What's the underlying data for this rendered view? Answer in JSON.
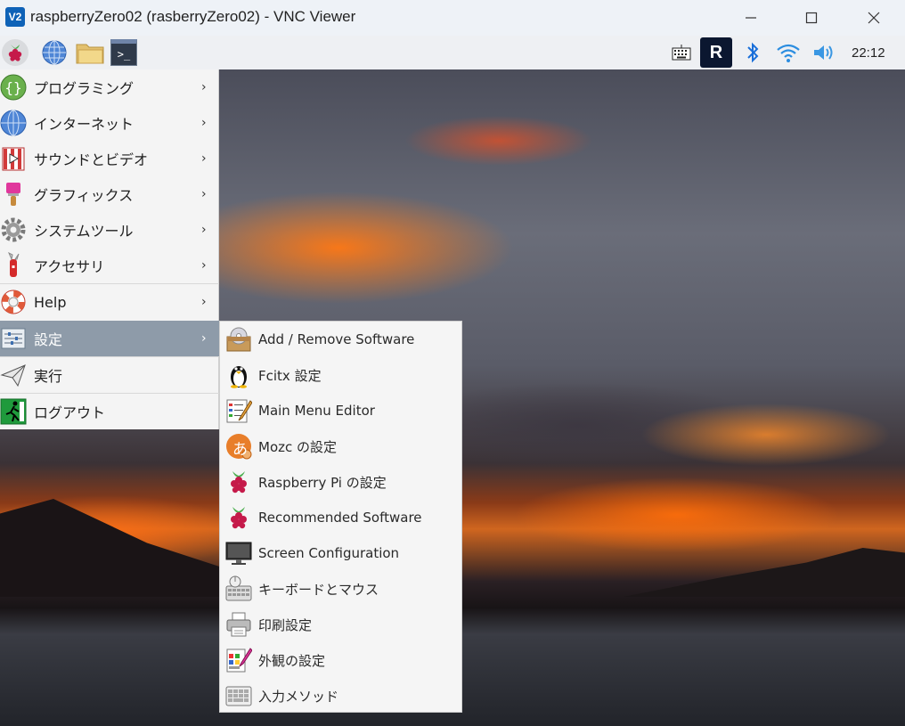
{
  "window": {
    "logo_text": "V2",
    "title": "raspberryZero02 (rasberryZero02) - VNC Viewer",
    "minimize": "—",
    "maximize": "☐",
    "close": "✕"
  },
  "panel": {
    "terminal_glyph": ">_",
    "vnc_tray_text": "R",
    "clock": "22:12"
  },
  "main_menu": {
    "items": [
      {
        "label": "プログラミング",
        "arrow": "›",
        "icon": "programming-icon"
      },
      {
        "label": "インターネット",
        "arrow": "›",
        "icon": "internet-globe-icon"
      },
      {
        "label": "サウンドとビデオ",
        "arrow": "›",
        "icon": "sound-video-icon"
      },
      {
        "label": "グラフィックス",
        "arrow": "›",
        "icon": "graphics-brush-icon"
      },
      {
        "label": "システムツール",
        "arrow": "›",
        "icon": "system-tools-gear-icon"
      },
      {
        "label": "アクセサリ",
        "arrow": "›",
        "icon": "accessories-knife-icon"
      },
      {
        "label": "Help",
        "arrow": "›",
        "icon": "help-lifebuoy-icon"
      },
      {
        "label": "設定",
        "arrow": "›",
        "icon": "settings-sliders-icon"
      },
      {
        "label": "実行",
        "icon": "run-paperplane-icon"
      },
      {
        "label": "ログアウト",
        "icon": "logout-exit-icon"
      }
    ],
    "active_index": 7
  },
  "settings_submenu": {
    "items": [
      {
        "label": "Add / Remove Software",
        "icon": "add-remove-software-icon"
      },
      {
        "label": "Fcitx 設定",
        "icon": "fcitx-penguin-icon"
      },
      {
        "label": "Main Menu Editor",
        "icon": "menu-editor-icon"
      },
      {
        "label": "Mozc の設定",
        "icon": "mozc-icon"
      },
      {
        "label": "Raspberry Pi の設定",
        "icon": "raspberry-pi-config-icon"
      },
      {
        "label": "Recommended Software",
        "icon": "raspberry-recommended-icon"
      },
      {
        "label": "Screen Configuration",
        "icon": "monitor-icon"
      },
      {
        "label": "キーボードとマウス",
        "icon": "keyboard-mouse-icon"
      },
      {
        "label": "印刷設定",
        "icon": "printer-icon"
      },
      {
        "label": "外観の設定",
        "icon": "appearance-icon"
      },
      {
        "label": "入力メソッド",
        "icon": "input-method-keyboard-icon"
      }
    ],
    "mozc_glyph": "あ"
  },
  "colors": {
    "menu_active": "#8e9ba9",
    "vnc_blue": "#0e62b7",
    "raspberry_red": "#c51a4a"
  }
}
